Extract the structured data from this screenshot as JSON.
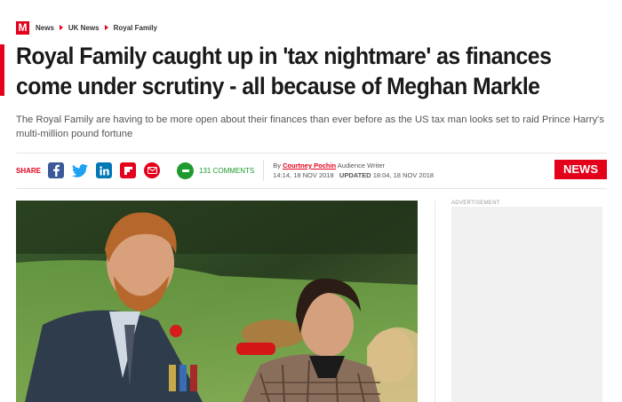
{
  "breadcrumb": {
    "logo": "M",
    "items": [
      "News",
      "UK News",
      "Royal Family"
    ]
  },
  "article": {
    "headline_line1": "Royal Family caught up in 'tax nightmare' as finances",
    "headline_line2": "come under scrutiny - all because of Meghan Markle",
    "standfirst": "The Royal Family are having to be more open about their finances than ever before as the US tax man looks set to raid Prince Harry's multi-million pound fortune"
  },
  "share": {
    "label": "SHARE",
    "icons": [
      "facebook-icon",
      "twitter-icon",
      "linkedin-icon",
      "flipboard-icon",
      "email-icon"
    ],
    "comments": "131 COMMENTS"
  },
  "byline": {
    "by": "By",
    "author": "Courtney Pochin",
    "role": "Audience Writer",
    "published": "14:14, 18 NOV 2018",
    "updated_label": "UPDATED",
    "updated": "18:04, 18 NOV 2018"
  },
  "section_badge": "NEWS",
  "advertisement": "ADVERTISEMENT",
  "colors": {
    "brand_red": "#e4001b",
    "facebook": "#3b5998",
    "twitter": "#1da1f2",
    "linkedin": "#0077b5",
    "comments_green": "#1e9a2f"
  }
}
